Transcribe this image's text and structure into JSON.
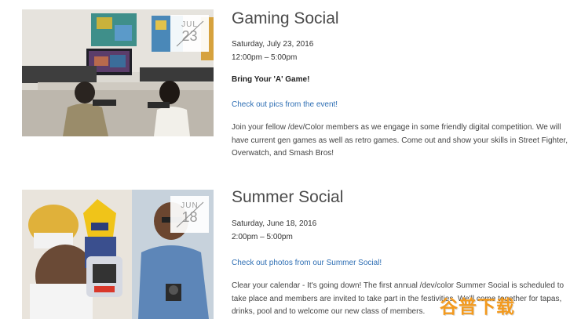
{
  "events": [
    {
      "title": "Gaming Social",
      "month": "JUL",
      "day": "23",
      "date": "Saturday, July 23, 2016",
      "time": "12:00pm – 5:00pm",
      "tagline": "Bring Your 'A' Game!",
      "link": "Check out pics from the event!",
      "description": "Join your fellow /dev/Color members as we engage in some friendly digital competition. We will have current gen games as well as retro games.  Come out and show your skills in Street Fighter, Overwatch, and Smash Bros!"
    },
    {
      "title": "Summer Social",
      "month": "JUN",
      "day": "18",
      "date": "Saturday, June 18, 2016",
      "time": "2:00pm – 5:00pm",
      "link": "Check out photos from our Summer Social!",
      "description": "Clear your calendar - It's going down! The first annual /dev/color Summer Social is scheduled to take place and members are invited to take part in the festivities. We'll come together for tapas, drinks, pool and to welcome  our new class of members."
    }
  ],
  "watermark": "谷普下载",
  "colors": {
    "link": "#2f6fb4",
    "watermark": "#f39a1e"
  }
}
